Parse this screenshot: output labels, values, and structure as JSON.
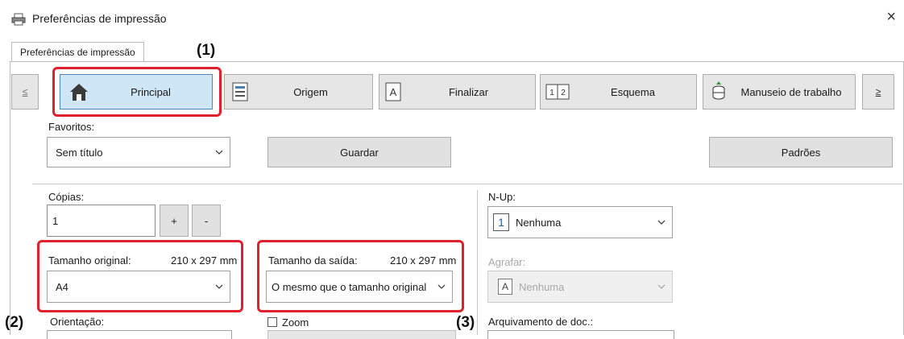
{
  "window": {
    "title": "Preferências de impressão",
    "close_symbol": "×"
  },
  "tabs": [
    {
      "label": "Preferências de impressão"
    }
  ],
  "callouts": {
    "c1": "(1)",
    "c2": "(2)",
    "c3": "(3)"
  },
  "nav": {
    "prev_symbol": "≤",
    "next_symbol": "≥",
    "items": [
      {
        "label": "Principal",
        "icon": "home-icon",
        "selected": true
      },
      {
        "label": "Origem",
        "icon": "paper-source-icon"
      },
      {
        "label": "Finalizar",
        "icon": "finishing-icon"
      },
      {
        "label": "Esquema",
        "icon": "layout-icon"
      },
      {
        "label": "Manuseio de trabalho",
        "icon": "job-handling-icon"
      }
    ]
  },
  "favoritos": {
    "label": "Favoritos:",
    "value": "Sem título",
    "save_label": "Guardar",
    "defaults_label": "Padrões"
  },
  "copias": {
    "label": "Cópias:",
    "value": "1",
    "plus": "+",
    "minus": "-"
  },
  "tamanho_original": {
    "label": "Tamanho original:",
    "dimensions": "210 x 297 mm",
    "value": "A4"
  },
  "tamanho_saida": {
    "label": "Tamanho da saída:",
    "dimensions": "210 x 297 mm",
    "value": "O mesmo que o tamanho original"
  },
  "orientacao": {
    "label": "Orientação:"
  },
  "zoom": {
    "label": "Zoom"
  },
  "nup": {
    "label": "N-Up:",
    "icon_number": "1",
    "value": "Nenhuma"
  },
  "agrafar": {
    "label": "Agrafar:",
    "icon_letter": "A",
    "value": "Nenhuma"
  },
  "arquivamento": {
    "label": "Arquivamento de doc.:"
  },
  "colors": {
    "accent_red": "#e0202c",
    "selected_tab": "#cfe6f6"
  }
}
